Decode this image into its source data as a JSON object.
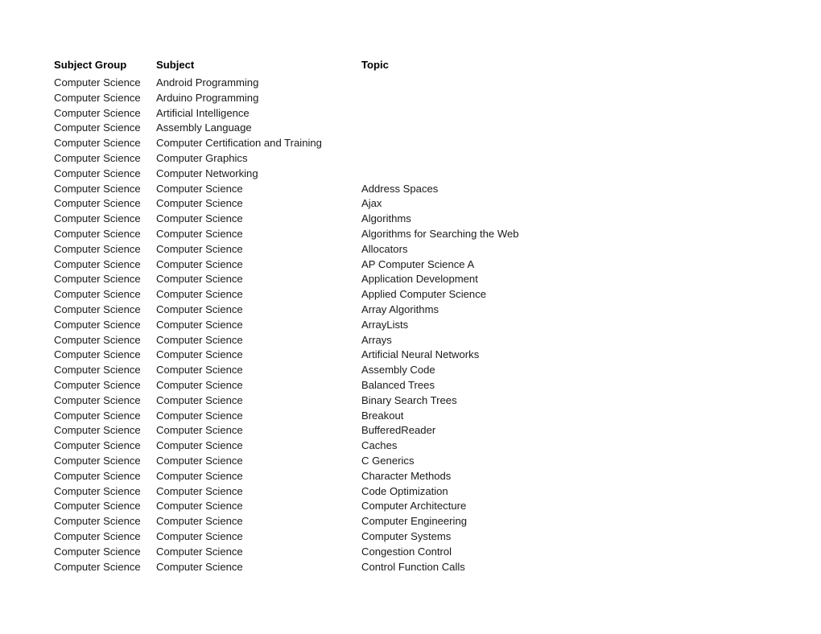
{
  "document": {
    "background_color": "#ffffff",
    "text_color": "#1a1a1a",
    "header_text_color": "#000000"
  },
  "table": {
    "columns": [
      {
        "key": "subject_group",
        "label": "Subject Group"
      },
      {
        "key": "subject",
        "label": "Subject"
      },
      {
        "key": "topic",
        "label": "Topic"
      }
    ],
    "rows": [
      {
        "subject_group": "Computer Science",
        "subject": "Android Programming",
        "topic": ""
      },
      {
        "subject_group": "Computer Science",
        "subject": "Arduino Programming",
        "topic": ""
      },
      {
        "subject_group": "Computer Science",
        "subject": "Artificial Intelligence",
        "topic": ""
      },
      {
        "subject_group": "Computer Science",
        "subject": "Assembly Language",
        "topic": ""
      },
      {
        "subject_group": "Computer Science",
        "subject": "Computer Certification and Training",
        "topic": ""
      },
      {
        "subject_group": "Computer Science",
        "subject": "Computer Graphics",
        "topic": ""
      },
      {
        "subject_group": "Computer Science",
        "subject": "Computer Networking",
        "topic": ""
      },
      {
        "subject_group": "Computer Science",
        "subject": "Computer Science",
        "topic": "Address Spaces"
      },
      {
        "subject_group": "Computer Science",
        "subject": "Computer Science",
        "topic": "Ajax"
      },
      {
        "subject_group": "Computer Science",
        "subject": "Computer Science",
        "topic": "Algorithms"
      },
      {
        "subject_group": "Computer Science",
        "subject": "Computer Science",
        "topic": "Algorithms for Searching the Web"
      },
      {
        "subject_group": "Computer Science",
        "subject": "Computer Science",
        "topic": "Allocators"
      },
      {
        "subject_group": "Computer Science",
        "subject": "Computer Science",
        "topic": "AP Computer Science A"
      },
      {
        "subject_group": "Computer Science",
        "subject": "Computer Science",
        "topic": "Application Development"
      },
      {
        "subject_group": "Computer Science",
        "subject": "Computer Science",
        "topic": "Applied Computer Science"
      },
      {
        "subject_group": "Computer Science",
        "subject": "Computer Science",
        "topic": "Array Algorithms"
      },
      {
        "subject_group": "Computer Science",
        "subject": "Computer Science",
        "topic": "ArrayLists"
      },
      {
        "subject_group": "Computer Science",
        "subject": "Computer Science",
        "topic": "Arrays"
      },
      {
        "subject_group": "Computer Science",
        "subject": "Computer Science",
        "topic": "Artificial Neural Networks"
      },
      {
        "subject_group": "Computer Science",
        "subject": "Computer Science",
        "topic": "Assembly Code"
      },
      {
        "subject_group": "Computer Science",
        "subject": "Computer Science",
        "topic": "Balanced Trees"
      },
      {
        "subject_group": "Computer Science",
        "subject": "Computer Science",
        "topic": "Binary Search Trees"
      },
      {
        "subject_group": "Computer Science",
        "subject": "Computer Science",
        "topic": "Breakout"
      },
      {
        "subject_group": "Computer Science",
        "subject": "Computer Science",
        "topic": "BufferedReader"
      },
      {
        "subject_group": "Computer Science",
        "subject": "Computer Science",
        "topic": "Caches"
      },
      {
        "subject_group": "Computer Science",
        "subject": "Computer Science",
        "topic": "C Generics"
      },
      {
        "subject_group": "Computer Science",
        "subject": "Computer Science",
        "topic": "Character Methods"
      },
      {
        "subject_group": "Computer Science",
        "subject": "Computer Science",
        "topic": "Code Optimization"
      },
      {
        "subject_group": "Computer Science",
        "subject": "Computer Science",
        "topic": "Computer Architecture"
      },
      {
        "subject_group": "Computer Science",
        "subject": "Computer Science",
        "topic": "Computer Engineering"
      },
      {
        "subject_group": "Computer Science",
        "subject": "Computer Science",
        "topic": "Computer Systems"
      },
      {
        "subject_group": "Computer Science",
        "subject": "Computer Science",
        "topic": "Congestion Control"
      },
      {
        "subject_group": "Computer Science",
        "subject": "Computer Science",
        "topic": "Control Function Calls"
      }
    ]
  }
}
